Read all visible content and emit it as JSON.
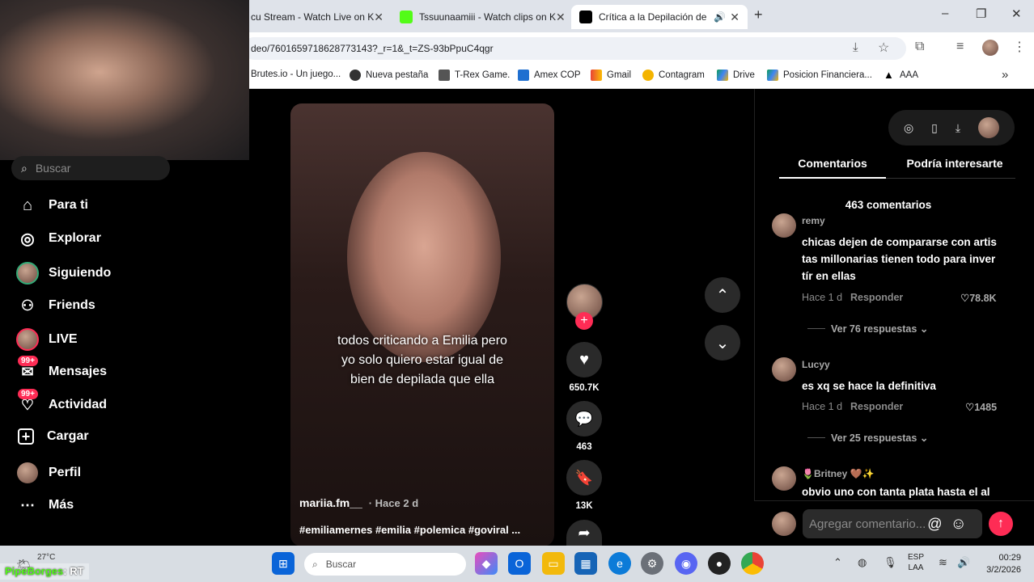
{
  "browser": {
    "tabs": [
      {
        "label": "cu Stream - Watch Live on K"
      },
      {
        "label": "Tssuunaamiii - Watch clips on K"
      },
      {
        "label": "Crítica a la Depilación de En"
      }
    ],
    "new_tab": "+",
    "url": "deo/7601659718628773143?_r=1&_t=ZS-93bPpuC4qgr",
    "bookmarks": [
      "Brutes.io - Un juego...",
      "Nueva pestaña",
      "T-Rex Game.",
      "Amex COP",
      "Gmail",
      "Contagram",
      "Drive",
      "Posicion Financiera...",
      "AAA"
    ],
    "window_controls": {
      "minimize": "–",
      "maximize": "❐",
      "close": "✕"
    }
  },
  "sidebar": {
    "search_placeholder": "Buscar",
    "items": [
      {
        "label": "Para ti",
        "icon": "home-icon"
      },
      {
        "label": "Explorar",
        "icon": "compass-icon"
      },
      {
        "label": "Siguiendo",
        "icon": "following-avatar-icon"
      },
      {
        "label": "Friends",
        "icon": "friends-icon"
      },
      {
        "label": "LIVE",
        "icon": "live-icon"
      },
      {
        "label": "Mensajes",
        "icon": "inbox-icon",
        "badge": "99+"
      },
      {
        "label": "Actividad",
        "icon": "activity-icon",
        "badge": "99+"
      },
      {
        "label": "Cargar",
        "icon": "upload-icon"
      },
      {
        "label": "Perfil",
        "icon": "profile-icon"
      },
      {
        "label": "Más",
        "icon": "more-icon"
      }
    ]
  },
  "video": {
    "caption": "todos criticando a Emilia pero yo solo quiero estar igual de bien de depilada que ella",
    "author": "mariia.fm__",
    "time": "· Hace 2 d",
    "hashtags": "#emiliamernes #emilia #polemica #goviral ..."
  },
  "actions": {
    "likes": "650.7K",
    "comments": "463",
    "saves": "13K",
    "follow": "+"
  },
  "comments_panel": {
    "tabs": [
      "Comentarios",
      "Podría interesarte"
    ],
    "count_label": "463 comentarios",
    "comments": [
      {
        "user": "remy",
        "text": "chicas dejen de compararse con artis tas millonarias tienen todo para inver tír en ellas",
        "time": "Hace 1 d",
        "reply": "Responder",
        "likes": "78.8K",
        "replies": "Ver 76 respuestas"
      },
      {
        "user": "Lucyy",
        "text": "es xq se hace la definitiva",
        "time": "Hace 1 d",
        "reply": "Responder",
        "likes": "1485",
        "replies": "Ver 25 respuestas"
      },
      {
        "user": "🌷Britney 🤎✨",
        "text": "obvio uno con tanta plata hasta el al"
      }
    ],
    "input_placeholder": "Agregar comentario...",
    "mention": "@",
    "emoji": "☺"
  },
  "stream_overlay": {
    "temperature": "27°C",
    "chat_user": "PipeBorges",
    "chat_text": ": RT"
  },
  "taskbar": {
    "search_placeholder": "Buscar",
    "lang": "ESP",
    "lang2": "LAA",
    "time": "00:29",
    "date": "3/2/2026"
  },
  "colors": {
    "accent": "#fe2c55",
    "background": "#000000",
    "taskbar": "#d8dde3"
  }
}
